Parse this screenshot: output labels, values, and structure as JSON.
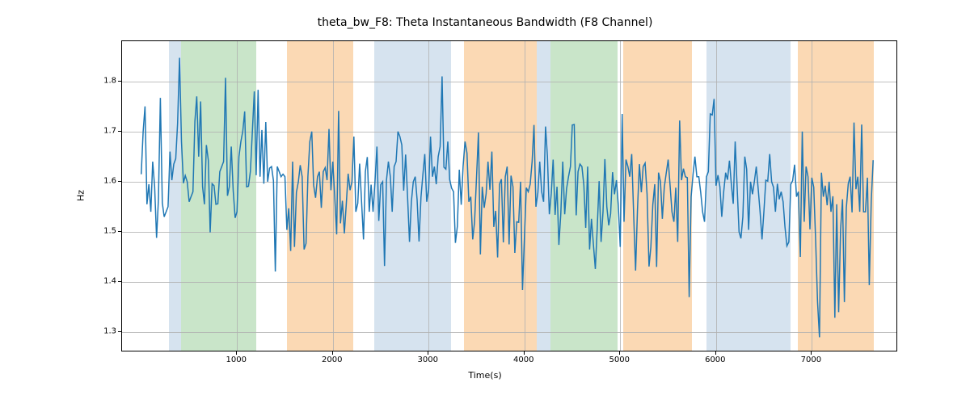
{
  "chart_data": {
    "type": "line",
    "title": "theta_bw_F8: Theta Instantaneous Bandwidth (F8 Channel)",
    "xlabel": "Time(s)",
    "ylabel": "Hz",
    "xlim": [
      -200,
      7900
    ],
    "ylim": [
      1.26,
      1.88
    ],
    "x_ticks": [
      1000,
      2000,
      3000,
      4000,
      5000,
      6000,
      7000
    ],
    "y_ticks": [
      1.3,
      1.4,
      1.5,
      1.6,
      1.7,
      1.8
    ],
    "band_colors": {
      "blue": "#d6e3ef",
      "green": "#c9e5c9",
      "orange": "#fbd9b4"
    },
    "bands": [
      {
        "x0": 290,
        "x1": 420,
        "c": "blue"
      },
      {
        "x0": 420,
        "x1": 1200,
        "c": "green"
      },
      {
        "x0": 1520,
        "x1": 1780,
        "c": "orange"
      },
      {
        "x0": 1780,
        "x1": 2210,
        "c": "orange"
      },
      {
        "x0": 2430,
        "x1": 3080,
        "c": "blue"
      },
      {
        "x0": 3080,
        "x1": 3230,
        "c": "blue"
      },
      {
        "x0": 3370,
        "x1": 4130,
        "c": "orange"
      },
      {
        "x0": 4130,
        "x1": 4270,
        "c": "blue"
      },
      {
        "x0": 4270,
        "x1": 4970,
        "c": "green"
      },
      {
        "x0": 5030,
        "x1": 5100,
        "c": "orange"
      },
      {
        "x0": 5100,
        "x1": 5750,
        "c": "orange"
      },
      {
        "x0": 5900,
        "x1": 5980,
        "c": "blue"
      },
      {
        "x0": 5980,
        "x1": 6780,
        "c": "blue"
      },
      {
        "x0": 6850,
        "x1": 6970,
        "c": "orange"
      },
      {
        "x0": 6970,
        "x1": 7650,
        "c": "orange"
      }
    ],
    "series": [
      {
        "name": "theta_bw_F8",
        "x_start": 0,
        "x_step": 20,
        "y": [
          1.615,
          1.7,
          1.75,
          1.555,
          1.595,
          1.54,
          1.64,
          1.59,
          1.488,
          1.565,
          1.767,
          1.558,
          1.53,
          1.54,
          1.55,
          1.66,
          1.603,
          1.635,
          1.646,
          1.716,
          1.847,
          1.68,
          1.597,
          1.612,
          1.6,
          1.56,
          1.57,
          1.58,
          1.72,
          1.77,
          1.65,
          1.76,
          1.59,
          1.555,
          1.673,
          1.643,
          1.499,
          1.596,
          1.592,
          1.555,
          1.556,
          1.62,
          1.63,
          1.64,
          1.807,
          1.572,
          1.59,
          1.67,
          1.582,
          1.528,
          1.54,
          1.65,
          1.68,
          1.7,
          1.74,
          1.59,
          1.591,
          1.621,
          1.7,
          1.78,
          1.613,
          1.783,
          1.61,
          1.703,
          1.596,
          1.719,
          1.6,
          1.627,
          1.63,
          1.602,
          1.421,
          1.63,
          1.62,
          1.61,
          1.615,
          1.61,
          1.504,
          1.547,
          1.462,
          1.64,
          1.47,
          1.579,
          1.6,
          1.633,
          1.61,
          1.465,
          1.477,
          1.61,
          1.68,
          1.7,
          1.593,
          1.568,
          1.61,
          1.62,
          1.548,
          1.62,
          1.628,
          1.603,
          1.705,
          1.583,
          1.64,
          1.57,
          1.495,
          1.741,
          1.517,
          1.562,
          1.497,
          1.553,
          1.616,
          1.583,
          1.6,
          1.69,
          1.54,
          1.557,
          1.636,
          1.56,
          1.485,
          1.62,
          1.649,
          1.54,
          1.594,
          1.54,
          1.6,
          1.67,
          1.522,
          1.594,
          1.6,
          1.432,
          1.603,
          1.64,
          1.61,
          1.54,
          1.63,
          1.64,
          1.7,
          1.69,
          1.673,
          1.582,
          1.654,
          1.57,
          1.48,
          1.56,
          1.6,
          1.61,
          1.564,
          1.481,
          1.569,
          1.613,
          1.655,
          1.56,
          1.585,
          1.69,
          1.61,
          1.63,
          1.595,
          1.65,
          1.67,
          1.81,
          1.629,
          1.625,
          1.68,
          1.604,
          1.587,
          1.58,
          1.478,
          1.511,
          1.624,
          1.554,
          1.63,
          1.68,
          1.657,
          1.56,
          1.57,
          1.485,
          1.52,
          1.608,
          1.698,
          1.455,
          1.59,
          1.548,
          1.576,
          1.64,
          1.584,
          1.66,
          1.51,
          1.542,
          1.449,
          1.595,
          1.605,
          1.479,
          1.61,
          1.63,
          1.475,
          1.612,
          1.59,
          1.458,
          1.52,
          1.519,
          1.6,
          1.384,
          1.49,
          1.588,
          1.58,
          1.595,
          1.64,
          1.713,
          1.55,
          1.578,
          1.64,
          1.58,
          1.56,
          1.71,
          1.651,
          1.535,
          1.577,
          1.644,
          1.534,
          1.59,
          1.474,
          1.537,
          1.64,
          1.535,
          1.586,
          1.61,
          1.63,
          1.713,
          1.714,
          1.533,
          1.62,
          1.635,
          1.63,
          1.593,
          1.508,
          1.63,
          1.465,
          1.526,
          1.475,
          1.426,
          1.51,
          1.601,
          1.48,
          1.54,
          1.645,
          1.55,
          1.513,
          1.536,
          1.619,
          1.575,
          1.603,
          1.553,
          1.47,
          1.735,
          1.52,
          1.644,
          1.63,
          1.61,
          1.655,
          1.535,
          1.423,
          1.543,
          1.635,
          1.579,
          1.63,
          1.637,
          1.575,
          1.431,
          1.47,
          1.554,
          1.595,
          1.43,
          1.618,
          1.6,
          1.526,
          1.589,
          1.617,
          1.644,
          1.594,
          1.54,
          1.52,
          1.588,
          1.48,
          1.722,
          1.603,
          1.626,
          1.61,
          1.608,
          1.37,
          1.57,
          1.615,
          1.65,
          1.61,
          1.61,
          1.578,
          1.54,
          1.52,
          1.61,
          1.62,
          1.735,
          1.733,
          1.765,
          1.592,
          1.613,
          1.59,
          1.53,
          1.58,
          1.618,
          1.604,
          1.642,
          1.594,
          1.556,
          1.68,
          1.59,
          1.5,
          1.487,
          1.53,
          1.65,
          1.625,
          1.504,
          1.6,
          1.575,
          1.6,
          1.63,
          1.585,
          1.54,
          1.485,
          1.542,
          1.603,
          1.601,
          1.655,
          1.6,
          1.589,
          1.54,
          1.596,
          1.565,
          1.58,
          1.56,
          1.51,
          1.472,
          1.48,
          1.595,
          1.602,
          1.634,
          1.57,
          1.58,
          1.45,
          1.7,
          1.52,
          1.63,
          1.61,
          1.505,
          1.608,
          1.589,
          1.48,
          1.36,
          1.29,
          1.618,
          1.57,
          1.592,
          1.553,
          1.6,
          1.54,
          1.571,
          1.329,
          1.555,
          1.34,
          1.505,
          1.565,
          1.36,
          1.548,
          1.596,
          1.61,
          1.539,
          1.718,
          1.585,
          1.61,
          1.54,
          1.714,
          1.54,
          1.54,
          1.608,
          1.394,
          1.56,
          1.643
        ]
      }
    ]
  }
}
